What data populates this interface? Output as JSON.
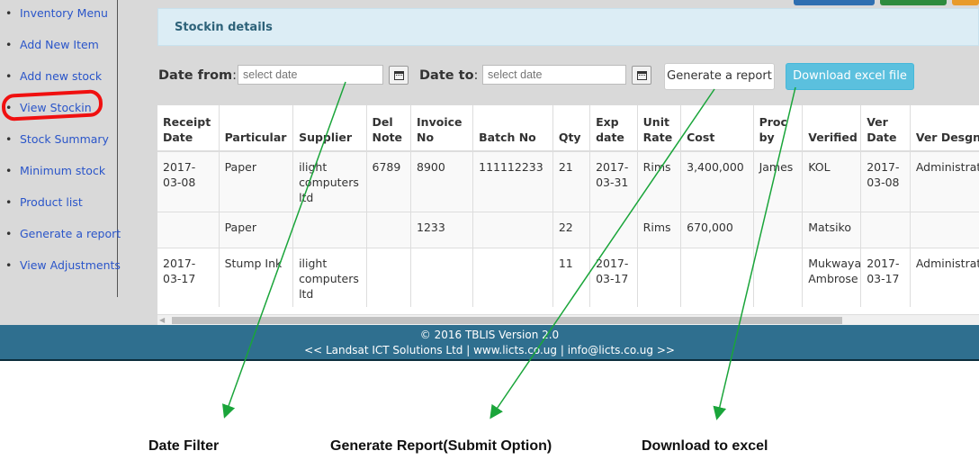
{
  "sidebar": {
    "items": [
      {
        "label": "Inventory Menu"
      },
      {
        "label": "Add New Item"
      },
      {
        "label": "Add new stock"
      },
      {
        "label": "View Stockin"
      },
      {
        "label": "Stock Summary"
      },
      {
        "label": "Minimum stock"
      },
      {
        "label": "Product list"
      },
      {
        "label": "Generate a report"
      },
      {
        "label": "View Adjustments"
      }
    ],
    "highlight_color": "#f01010"
  },
  "panel": {
    "title": "Stockin details"
  },
  "filter": {
    "from_label": "Date from",
    "from_placeholder": "select date",
    "to_label": "Date to",
    "to_placeholder": "select date",
    "generate_label": "Generate a report",
    "download_label": "Download excel file"
  },
  "table": {
    "headers": [
      "Receipt Date",
      "Particular",
      "Supplier",
      "Del Note",
      "Invoice No",
      "Batch No",
      "Qty",
      "Exp date",
      "Unit Rate",
      "Cost",
      "Proc by",
      "Verified",
      "Ver Date",
      "Ver Desgn"
    ],
    "rows": [
      [
        "2017-03-08",
        "Paper",
        "ilight computers ltd",
        "6789",
        "8900",
        "111112233",
        "21",
        "2017-03-31",
        "Rims",
        "3,400,000",
        "James",
        "KOL",
        "2017-03-08",
        "Administrator"
      ],
      [
        "",
        "Paper",
        "",
        "",
        "1233",
        "",
        "22",
        "",
        "Rims",
        "670,000",
        "",
        "Matsiko",
        "",
        ""
      ],
      [
        "2017-03-17",
        "Stump Ink",
        "ilight computers ltd",
        "",
        "",
        "",
        "11",
        "2017-03-17",
        "",
        "",
        "",
        "Mukwaya Ambrose",
        "2017-03-17",
        "Administrator"
      ]
    ]
  },
  "footer": {
    "line1": "© 2016 TBLIS Version 2.0",
    "line2": "<< Landsat ICT Solutions Ltd | www.licts.co.ug | info@licts.co.ug >>"
  },
  "annotations": {
    "date_filter": "Date Filter",
    "generate_report": "Generate Report(Submit Option)",
    "download_excel": "Download to excel",
    "arrow_color": "#1aa53a"
  },
  "colors": {
    "footer_bg": "#2f6f8f",
    "panel_bg": "#dcedf5",
    "download_btn": "#5bc0de",
    "link": "#2a55c9"
  }
}
